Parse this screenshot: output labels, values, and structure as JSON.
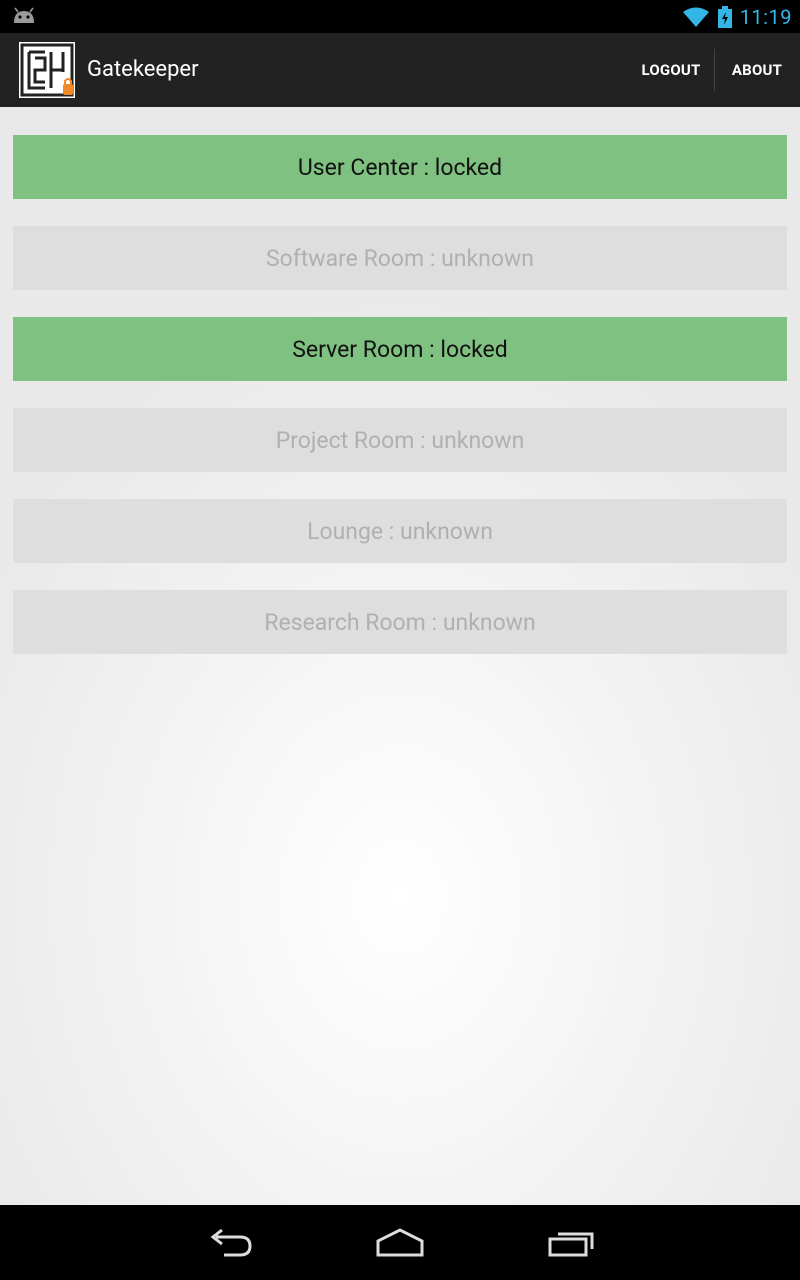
{
  "status_bar": {
    "time": "11:19",
    "icons": [
      "android-notification-icon",
      "wifi-icon",
      "battery-charging-icon"
    ]
  },
  "action_bar": {
    "title": "Gatekeeper",
    "logout_label": "LOGOUT",
    "about_label": "ABOUT"
  },
  "rooms": [
    {
      "label": "User Center : locked",
      "state": "locked"
    },
    {
      "label": "Software Room : unknown",
      "state": "unknown"
    },
    {
      "label": "Server Room : locked",
      "state": "locked"
    },
    {
      "label": "Project Room : unknown",
      "state": "unknown"
    },
    {
      "label": "Lounge : unknown",
      "state": "unknown"
    },
    {
      "label": "Research Room : unknown",
      "state": "unknown"
    }
  ],
  "colors": {
    "locked": "#7fc181",
    "unknown": "#dedede",
    "status_accent": "#33b5e5"
  },
  "nav_bar": {
    "icons": [
      "back-icon",
      "home-icon",
      "recents-icon"
    ]
  }
}
